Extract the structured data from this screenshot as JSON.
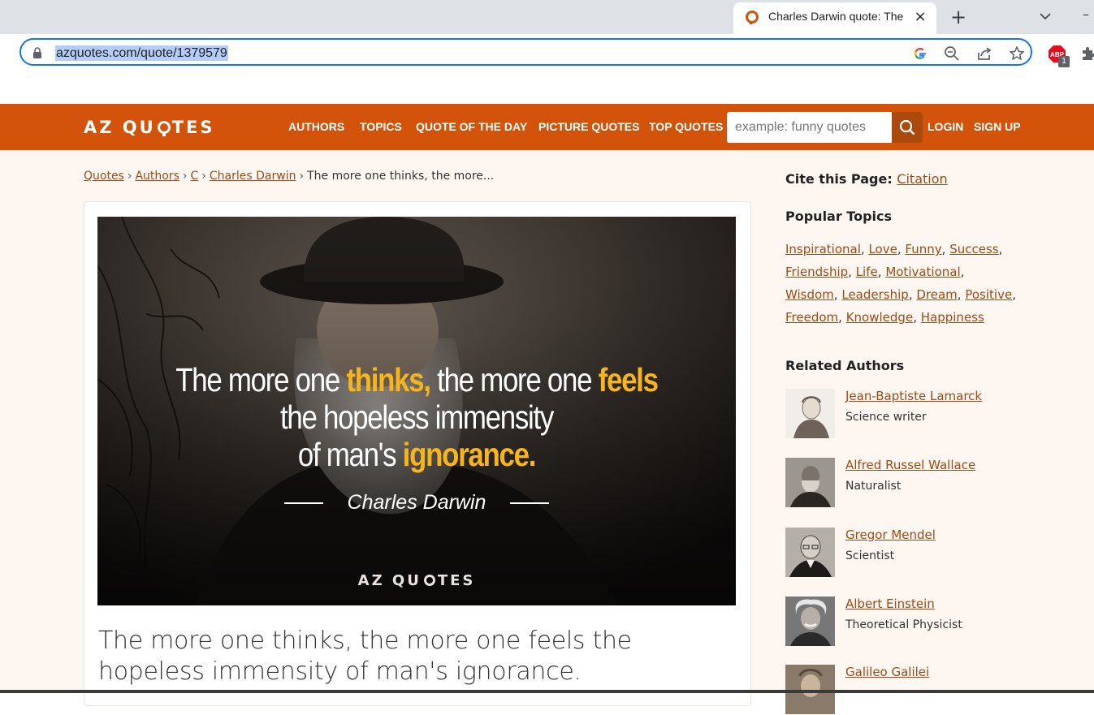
{
  "browser": {
    "tab_title": "Charles Darwin quote: The more one thinks, the more one feels the hopeless immensity",
    "tab_close": "×",
    "new_tab": "+",
    "url": "azquotes.com/quote/1379579",
    "accent": "#1a73e8",
    "abp_badge": "1"
  },
  "header": {
    "logo_left": "AZ QU",
    "logo_right": "TES",
    "brand_color": "#d25309",
    "nav": [
      "AUTHORS",
      "TOPICS",
      "QUOTE OF THE DAY",
      "PICTURE QUOTES",
      "TOP QUOTES"
    ],
    "search_placeholder": "example: funny quotes",
    "login": "LOGIN",
    "signup": "SIGN UP"
  },
  "breadcrumb": [
    "Quotes",
    "Authors",
    "C",
    "Charles Darwin"
  ],
  "breadcrumb_sep": "›",
  "breadcrumb_current": "The more one thinks, the more...",
  "quote_image": {
    "line1_a": "The more one ",
    "line1_b": "thinks,",
    "line1_c": " the more one ",
    "line1_d": "feels",
    "line2": "the hopeless immensity",
    "line3_a": "of man's ",
    "line3_b": "ignorance.",
    "author": "Charles Darwin",
    "logo_left": "AZ QU",
    "logo_right": "TES",
    "highlight_color": "#f6b51d"
  },
  "quote_text": "The more one thinks, the more one feels the hopeless immensity of man's ignorance.",
  "sidebar": {
    "cite_label": "Cite this Page:",
    "cite_link": "Citation",
    "popular_topics_heading": "Popular Topics",
    "topics": [
      "Inspirational",
      "Love",
      "Funny",
      "Success",
      "Friendship",
      "Life",
      "Motivational",
      "Wisdom",
      "Leadership",
      "Dream",
      "Positive",
      "Freedom",
      "Knowledge",
      "Happiness"
    ],
    "topic_sep": ",",
    "related_authors_heading": "Related Authors",
    "authors": [
      {
        "name": "Jean-Baptiste Lamarck",
        "role": "Science writer"
      },
      {
        "name": "Alfred Russel Wallace",
        "role": "Naturalist"
      },
      {
        "name": "Gregor Mendel",
        "role": "Scientist"
      },
      {
        "name": "Albert Einstein",
        "role": "Theoretical Physicist"
      },
      {
        "name": "Galileo Galilei",
        "role": ""
      }
    ]
  }
}
